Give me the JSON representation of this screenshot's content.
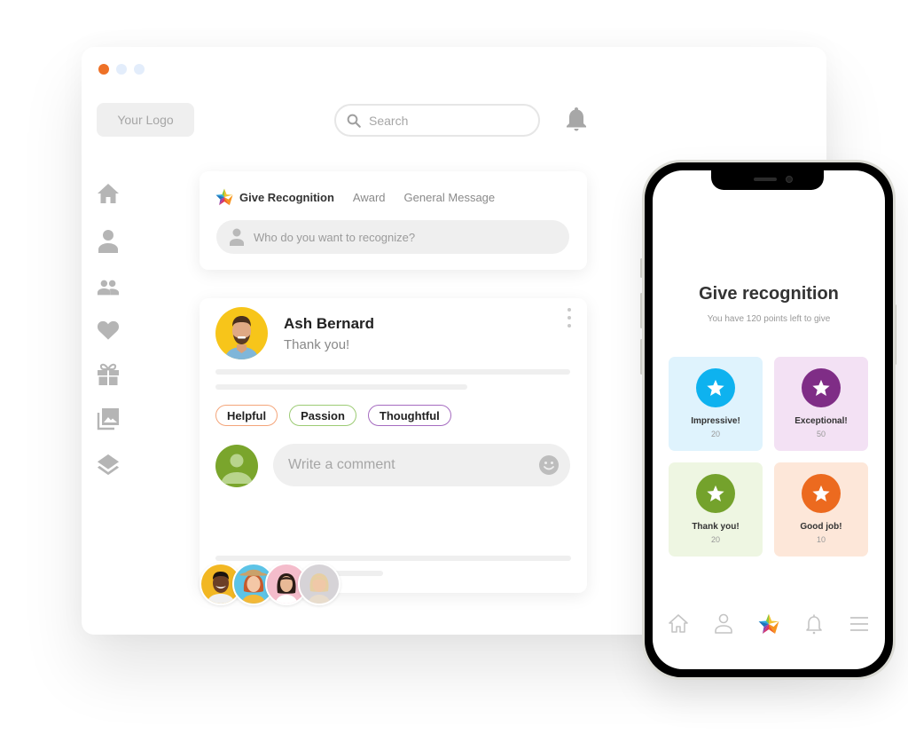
{
  "window": {
    "dots": [
      {
        "name": "close",
        "color": "#ee7127"
      },
      {
        "name": "minimize",
        "color": "#e3edfb"
      },
      {
        "name": "maximize",
        "color": "#e3edfb"
      }
    ],
    "logo": "Your Logo",
    "search": {
      "placeholder": "Search",
      "value": ""
    },
    "sidebar": [
      {
        "icon": "home-icon"
      },
      {
        "icon": "person-icon"
      },
      {
        "icon": "people-icon"
      },
      {
        "icon": "heart-icon"
      },
      {
        "icon": "gift-icon"
      },
      {
        "icon": "gallery-icon"
      },
      {
        "icon": "layers-icon"
      }
    ]
  },
  "give_card": {
    "tabs": [
      {
        "label": "Give Recognition",
        "active": true
      },
      {
        "label": "Award",
        "active": false
      },
      {
        "label": "General Message",
        "active": false
      }
    ],
    "recipient": {
      "placeholder": "Who do you want to recognize?",
      "value": ""
    }
  },
  "post": {
    "name": "Ash Bernard",
    "message": "Thank you!",
    "tags": [
      {
        "label": "Helpful",
        "color": "#f4a57a"
      },
      {
        "label": "Passion",
        "color": "#9ccb74"
      },
      {
        "label": "Thoughtful",
        "color": "#a56bc0"
      }
    ],
    "comment": {
      "placeholder": "Write a comment",
      "value": ""
    }
  },
  "avatars_count": 4,
  "phone": {
    "title": "Give recognition",
    "subtitle": "You have 120 points left to give",
    "options": [
      {
        "label": "Impressive!",
        "points": "20",
        "bg": "#dff3fd",
        "accent": "#0eb2ef"
      },
      {
        "label": "Exceptional!",
        "points": "50",
        "bg": "#f3e1f4",
        "accent": "#7f2d86"
      },
      {
        "label": "Thank you!",
        "points": "20",
        "bg": "#eef6e2",
        "accent": "#74a22c"
      },
      {
        "label": "Good job!",
        "points": "10",
        "bg": "#fde7d9",
        "accent": "#ec6a1f"
      }
    ],
    "tabbar": [
      {
        "icon": "home-outline-icon",
        "active": false
      },
      {
        "icon": "profile-outline-icon",
        "active": false
      },
      {
        "icon": "recognition-star-icon",
        "active": true
      },
      {
        "icon": "bell-outline-icon",
        "active": false
      },
      {
        "icon": "menu-icon",
        "active": false
      }
    ]
  }
}
